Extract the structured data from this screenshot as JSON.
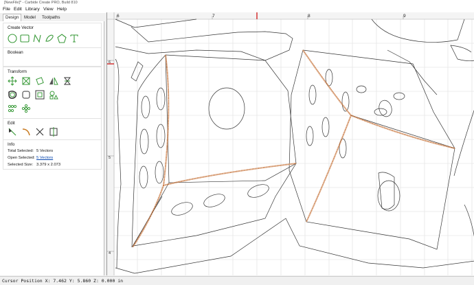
{
  "window": {
    "title": "[NewFile]* - Carbide Create PRO, Build 810"
  },
  "menu": [
    "File",
    "Edit",
    "Library",
    "View",
    "Help"
  ],
  "tabs": [
    "Design",
    "Model",
    "Toolpaths"
  ],
  "active_tab": "Design",
  "sections": {
    "create_vector": {
      "title": "Create Vector",
      "tools": [
        "circle-icon",
        "ellipse-icon",
        "curve-icon",
        "polygon-icon",
        "pentagon-icon",
        "text-icon"
      ]
    },
    "boolean": {
      "title": "Boolean"
    },
    "transform": {
      "title": "Transform",
      "tools": [
        "move-icon",
        "resize-icon",
        "rotate-icon",
        "mirror-icon",
        "align-icon",
        "offset-icon",
        "rounded-rect-icon",
        "group-icon",
        "shape-tools-icon",
        "circle-array-icon",
        "ring-array-icon"
      ]
    },
    "edit": {
      "title": "Edit",
      "tools": [
        "node-edit-icon",
        "smooth-icon",
        "trim-icon",
        "join-icon"
      ]
    },
    "info": {
      "title": "Info",
      "rows": [
        {
          "label": "Total Selected:",
          "value": "5 Vectors"
        },
        {
          "label": "Open Selected:",
          "value": "5 Vectors"
        },
        {
          "label": "Selected Size:",
          "value": "3.379 x 2.073"
        }
      ]
    }
  },
  "ruler": {
    "top_labels": [
      "6",
      "7",
      "8",
      "9"
    ],
    "left_labels": [
      "6",
      "5",
      "4"
    ]
  },
  "colors": {
    "accent": "#3a9a3a",
    "selection": "#c8773f",
    "vector": "#333333",
    "grid": "#d8d8d8"
  },
  "status": {
    "cursor": "Cursor Position X: 7.462 Y: 5.860 Z: 0.000 in"
  }
}
